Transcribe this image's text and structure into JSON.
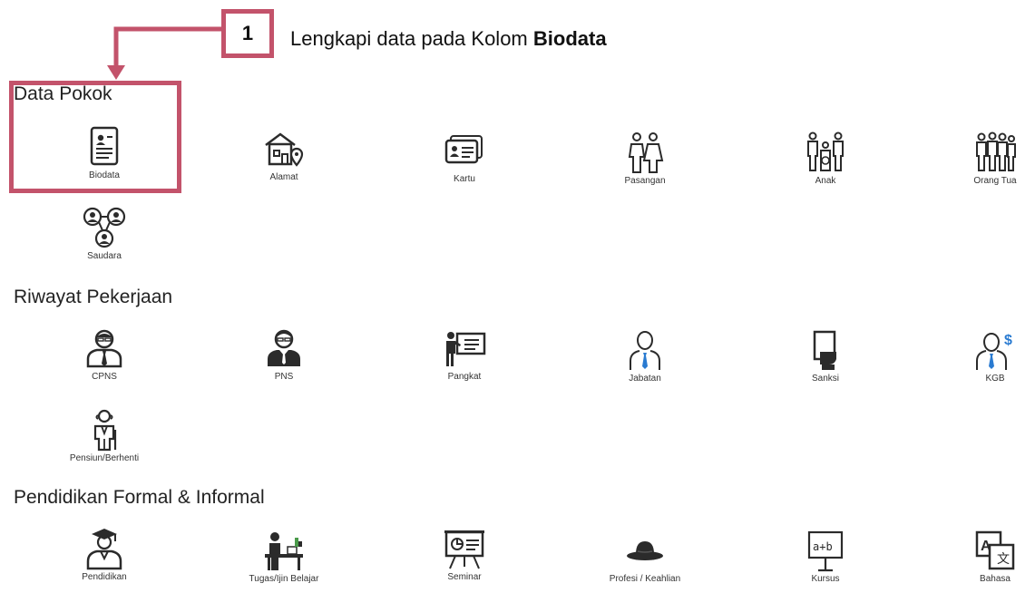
{
  "callout": {
    "step_number": "1",
    "instruction_prefix": "Lengkapi data pada Kolom ",
    "instruction_bold": "Biodata"
  },
  "sections": {
    "data_pokok": {
      "title": "Data Pokok",
      "items": [
        {
          "label": "Biodata",
          "icon": "id-card-icon"
        },
        {
          "label": "Alamat",
          "icon": "house-pin-icon"
        },
        {
          "label": "Kartu",
          "icon": "card-icon"
        },
        {
          "label": "Pasangan",
          "icon": "couple-icon"
        },
        {
          "label": "Anak",
          "icon": "family-icon"
        },
        {
          "label": "Orang Tua",
          "icon": "elders-icon"
        },
        {
          "label": "Saudara",
          "icon": "siblings-icon"
        }
      ]
    },
    "riwayat_pekerjaan": {
      "title": "Riwayat Pekerjaan",
      "items": [
        {
          "label": "CPNS",
          "icon": "employee-icon"
        },
        {
          "label": "PNS",
          "icon": "officer-icon"
        },
        {
          "label": "Pangkat",
          "icon": "presenter-icon"
        },
        {
          "label": "Jabatan",
          "icon": "tie-person-icon"
        },
        {
          "label": "Sanksi",
          "icon": "sanction-icon"
        },
        {
          "label": "KGB",
          "icon": "salary-person-icon"
        },
        {
          "label": "Pensiun/Berhenti",
          "icon": "retiree-icon"
        }
      ]
    },
    "pendidikan": {
      "title": "Pendidikan Formal & Informal",
      "items": [
        {
          "label": "Pendidikan",
          "icon": "graduate-icon"
        },
        {
          "label": "Tugas/Ijin Belajar",
          "icon": "study-desk-icon"
        },
        {
          "label": "Seminar",
          "icon": "seminar-board-icon"
        },
        {
          "label": "Profesi / Keahlian",
          "icon": "hat-icon"
        },
        {
          "label": "Kursus",
          "icon": "course-board-icon"
        },
        {
          "label": "Bahasa",
          "icon": "translate-icon"
        }
      ]
    }
  },
  "colors": {
    "highlight": "#c3536b",
    "icon_dark": "#2b2b2b",
    "icon_blue": "#2a7bd1"
  }
}
